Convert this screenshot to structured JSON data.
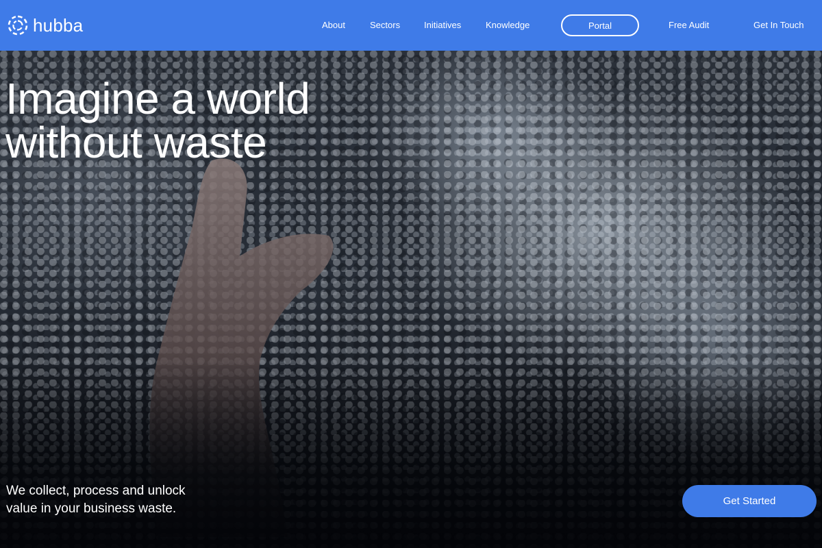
{
  "header": {
    "brand": "hubba",
    "background_color": "#3f7be8",
    "logo_icon": "hubba-logo-ring-icon",
    "nav": {
      "about": "About",
      "sectors": "Sectors",
      "initiatives": "Initiatives",
      "knowledge": "Knowledge",
      "portal": "Portal",
      "free_audit": "Free Audit",
      "get_in_touch": "Get In Touch"
    }
  },
  "hero": {
    "title_line1": "Imagine a world",
    "title_line2": "without waste",
    "subtitle_line1": "We collect, process and unlock",
    "subtitle_line2": "value in your business waste.",
    "cta_label": "Get Started",
    "cta_color": "#3f7be8",
    "background_image": "hand-in-plastic-pellets-photo"
  }
}
